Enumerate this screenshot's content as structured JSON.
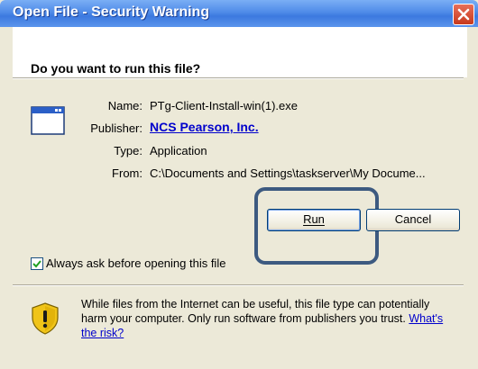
{
  "window": {
    "title": "Open File - Security Warning",
    "close_icon": "close-icon"
  },
  "question": "Do you want to run this file?",
  "file": {
    "icon": "application-window-icon",
    "fields": {
      "name_label": "Name:",
      "name_value": "PTg-Client-Install-win(1).exe",
      "publisher_label": "Publisher:",
      "publisher_value": "NCS Pearson, Inc.",
      "type_label": "Type:",
      "type_value": "Application",
      "from_label": "From:",
      "from_value": "C:\\Documents and Settings\\taskserver\\My Docume..."
    }
  },
  "buttons": {
    "run_label": "Run",
    "cancel_label": "Cancel"
  },
  "checkbox": {
    "label": "Always ask before opening this file",
    "checked": true
  },
  "warning": {
    "icon": "shield-warning-icon",
    "text": "While files from the Internet can be useful, this file type can potentially harm your computer. Only run software from publishers you trust.",
    "link": "What's the risk?"
  },
  "colors": {
    "titlebar": "#3c79df",
    "link": "#0000cc",
    "focus_ring": "#3d5a80",
    "dialog_bg": "#ece9d8"
  }
}
